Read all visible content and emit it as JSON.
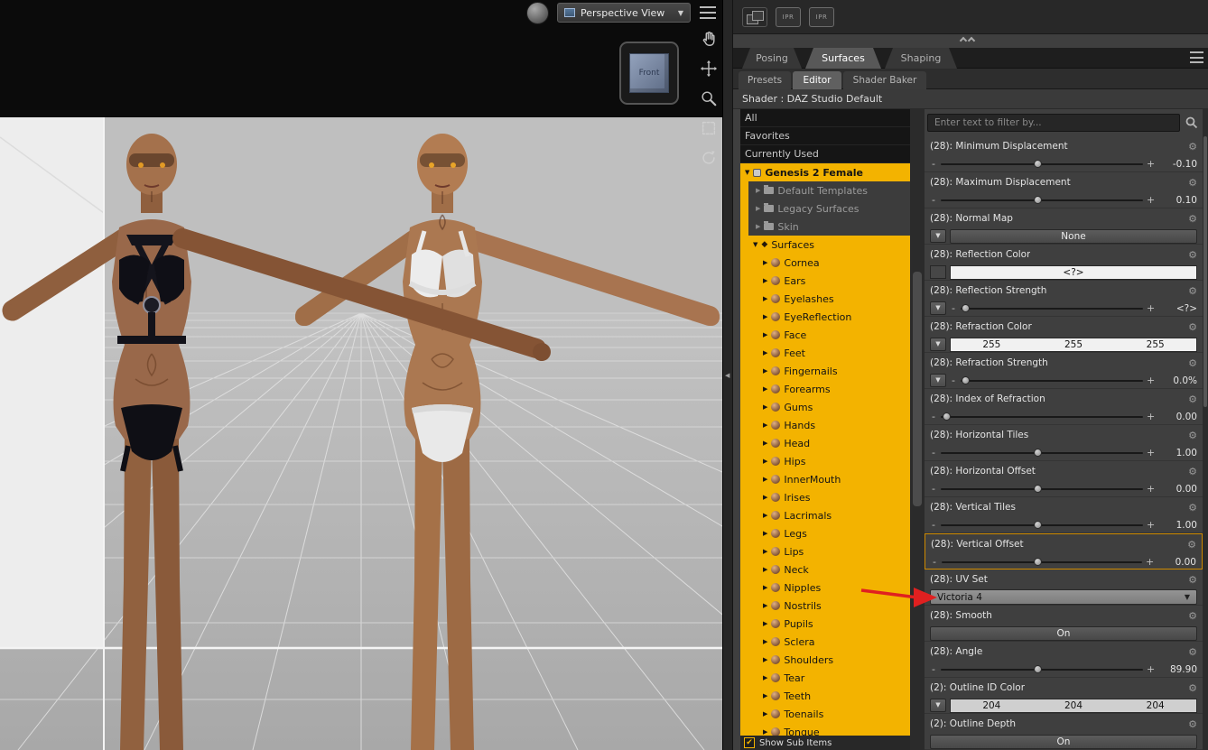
{
  "colors": {
    "accent": "#f3b300",
    "highlight_border": "#cf8a00",
    "arrow": "#e02020"
  },
  "icons": {
    "gear": "⚙",
    "tri_down": "▼",
    "tri_right": "▶",
    "tri_left": "◀",
    "diamond": "◆",
    "check": "✔",
    "minus": "-",
    "plus": "+"
  },
  "viewport": {
    "view_selector_label": "Perspective View",
    "cube_face_label": "Front"
  },
  "panel": {
    "toolbar": {
      "ipr1": "IPR",
      "ipr2": "IPR"
    },
    "tabs": [
      {
        "label": "Posing",
        "active": false
      },
      {
        "label": "Surfaces",
        "active": true
      },
      {
        "label": "Shaping",
        "active": false
      }
    ],
    "subtabs": [
      {
        "label": "Presets",
        "active": false
      },
      {
        "label": "Editor",
        "active": true
      },
      {
        "label": "Shader Baker",
        "active": false
      }
    ],
    "shader_label": "Shader : DAZ Studio Default"
  },
  "tree": {
    "top_items": [
      "All",
      "Favorites",
      "Currently Used"
    ],
    "root_label": "Genesis 2 Female",
    "groups": [
      "Default Templates",
      "Legacy Surfaces",
      "Skin"
    ],
    "surfaces_label": "Surfaces",
    "surfaces": [
      "Cornea",
      "Ears",
      "Eyelashes",
      "EyeReflection",
      "Face",
      "Feet",
      "Fingernails",
      "Forearms",
      "Gums",
      "Hands",
      "Head",
      "Hips",
      "InnerMouth",
      "Irises",
      "Lacrimals",
      "Legs",
      "Lips",
      "Neck",
      "Nipples",
      "Nostrils",
      "Pupils",
      "Sclera",
      "Shoulders",
      "Tear",
      "Teeth",
      "Toenails",
      "Tongue"
    ],
    "show_sub_items_label": "Show Sub Items"
  },
  "properties": {
    "filter_placeholder": "Enter text to filter by...",
    "items": [
      {
        "label": "(28): Minimum Displacement",
        "type": "slider",
        "value": "-0.10",
        "pos": 48
      },
      {
        "label": "(28): Maximum Displacement",
        "type": "slider",
        "value": "0.10",
        "pos": 48
      },
      {
        "label": "(28): Normal Map",
        "type": "dropdown",
        "value": "None"
      },
      {
        "label": "(28): Reflection Color",
        "type": "color",
        "value": "<?>",
        "swatch": "#f1f1f1"
      },
      {
        "label": "(28): Reflection Strength",
        "type": "slider",
        "dd": true,
        "value": "<?>",
        "pos": 3
      },
      {
        "label": "(28): Refraction Color",
        "type": "color3",
        "dd": true,
        "values": [
          "255",
          "255",
          "255"
        ],
        "swatch": "#f1f1f1"
      },
      {
        "label": "(28): Refraction Strength",
        "type": "slider",
        "dd": true,
        "value": "0.0%",
        "pos": 3
      },
      {
        "label": "(28): Index of Refraction",
        "type": "slider",
        "value": "0.00",
        "pos": 3
      },
      {
        "label": "(28): Horizontal Tiles",
        "type": "slider",
        "value": "1.00",
        "pos": 48
      },
      {
        "label": "(28): Horizontal Offset",
        "type": "slider",
        "value": "0.00",
        "pos": 48
      },
      {
        "label": "(28): Vertical Tiles",
        "type": "slider",
        "value": "1.00",
        "pos": 48
      },
      {
        "label": "(28): Vertical Offset",
        "type": "slider",
        "value": "0.00",
        "pos": 48,
        "highlight": true
      },
      {
        "label": "(28): UV Set",
        "type": "select",
        "value": "Victoria 4"
      },
      {
        "label": "(28): Smooth",
        "type": "toggle",
        "value": "On"
      },
      {
        "label": "(28): Angle",
        "type": "slider",
        "value": "89.90",
        "pos": 48
      },
      {
        "label": "(2): Outline ID Color",
        "type": "color3",
        "dd": true,
        "values": [
          "204",
          "204",
          "204"
        ],
        "swatch": "#cfcfcf"
      },
      {
        "label": "(2): Outline Depth",
        "type": "toggle",
        "value": "On"
      }
    ]
  }
}
